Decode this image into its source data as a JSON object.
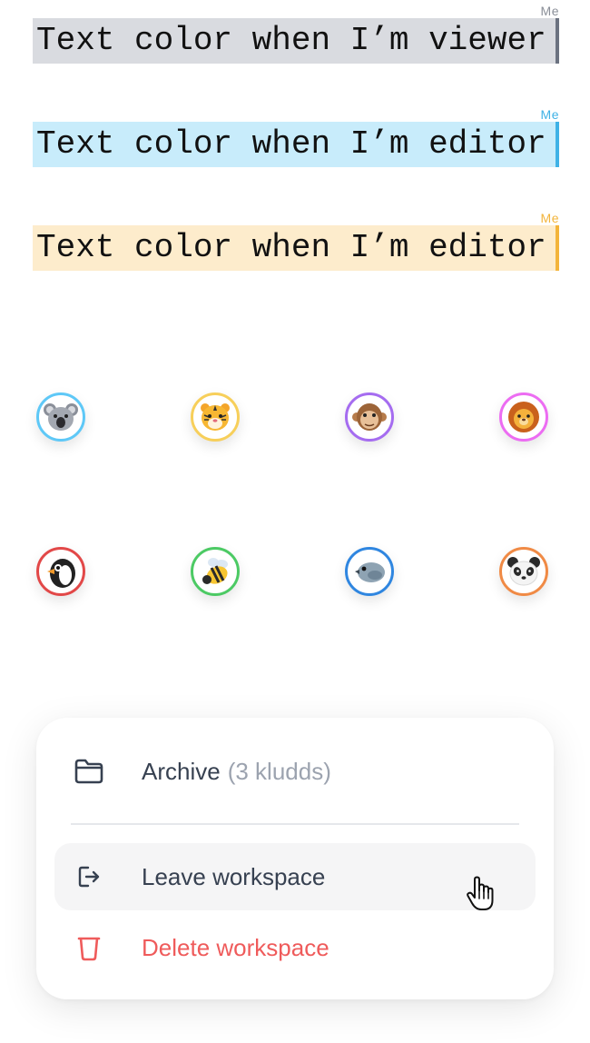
{
  "samples": [
    {
      "me_label": "Me",
      "text": "Text color when I’m viewer",
      "role": "viewer",
      "highlight": "#d9dbe0",
      "caret": "#6b7280",
      "me_color": "#8a8f98"
    },
    {
      "me_label": "Me",
      "text": "Text color when I’m editor",
      "role": "editor",
      "highlight": "#c8ecfb",
      "caret": "#3fb2e6",
      "me_color": "#3fb2e6"
    },
    {
      "me_label": "Me",
      "text": "Text color when I’m editor",
      "role": "editor",
      "highlight": "#fdeccc",
      "caret": "#f3b43b",
      "me_color": "#f3b43b"
    }
  ],
  "avatars": [
    {
      "name": "koala-icon",
      "ring": "#5ec8f7"
    },
    {
      "name": "tiger-icon",
      "ring": "#f7cf5a"
    },
    {
      "name": "monkey-icon",
      "ring": "#a56cf0"
    },
    {
      "name": "lion-icon",
      "ring": "#ec6cf2"
    },
    {
      "name": "penguin-icon",
      "ring": "#e24848"
    },
    {
      "name": "bee-icon",
      "ring": "#4cca64"
    },
    {
      "name": "bird-icon",
      "ring": "#2f86e0"
    },
    {
      "name": "panda-icon",
      "ring": "#f08a45"
    }
  ],
  "menu": {
    "archive_label": "Archive",
    "archive_count": "(3 kludds)",
    "leave_label": "Leave workspace",
    "delete_label": "Delete workspace",
    "delete_color": "#ef5b5b"
  }
}
